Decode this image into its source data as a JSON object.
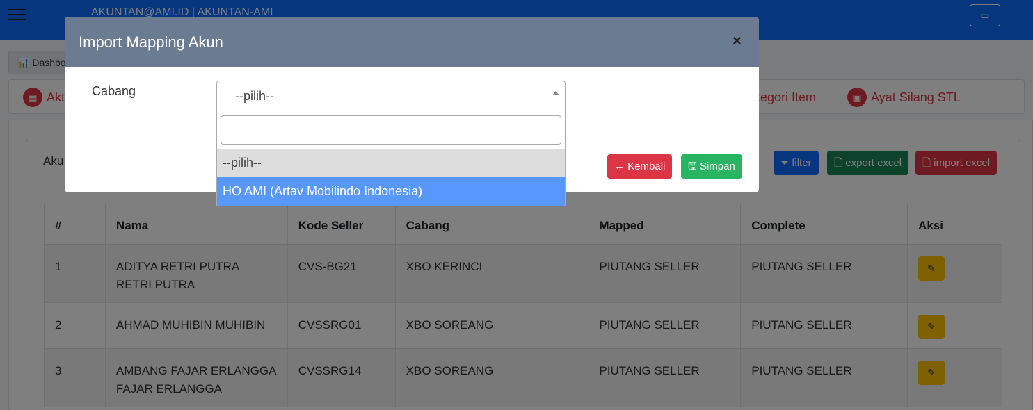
{
  "topbar": {
    "user_label": "AKUNTAN@AMI.ID | AKUNTAN-AMI"
  },
  "breadcrumb": {
    "label": "Dashbo"
  },
  "nav": {
    "item_left": "Akt",
    "item_kategori": "tegori Item",
    "item_ayat": "Ayat Silang STL"
  },
  "card": {
    "title": "Aku"
  },
  "actions": {
    "filter": "filter",
    "export": "export excel",
    "import": "import excel"
  },
  "table": {
    "headers": {
      "no": "#",
      "nama": "Nama",
      "kode": "Kode Seller",
      "cabang": "Cabang",
      "mapped": "Mapped",
      "complete": "Complete",
      "aksi": "Aksi"
    },
    "rows": [
      {
        "no": "1",
        "nama": "ADITYA RETRI PUTRA RETRI PUTRA",
        "kode": "CVS-BG21",
        "cabang": "XBO KERINCI",
        "mapped": "PIUTANG SELLER",
        "complete": "PIUTANG SELLER"
      },
      {
        "no": "2",
        "nama": "AHMAD MUHIBIN MUHIBIN",
        "kode": "CVSSRG01",
        "cabang": "XBO SOREANG",
        "mapped": "PIUTANG SELLER",
        "complete": "PIUTANG SELLER"
      },
      {
        "no": "3",
        "nama": "AMBANG FAJAR ERLANGGA FAJAR ERLANGGA",
        "kode": "CVSSRG14",
        "cabang": "XBO SOREANG",
        "mapped": "PIUTANG SELLER",
        "complete": "PIUTANG SELLER"
      }
    ]
  },
  "modal": {
    "title": "Import Mapping Akun",
    "close": "×",
    "field_label": "Cabang",
    "select_value": "--pilih--",
    "options": [
      "--pilih--",
      "HO AMI (Artav Mobilindo Indonesia)"
    ],
    "back_label": "Kembali",
    "save_label": "Simpan"
  }
}
